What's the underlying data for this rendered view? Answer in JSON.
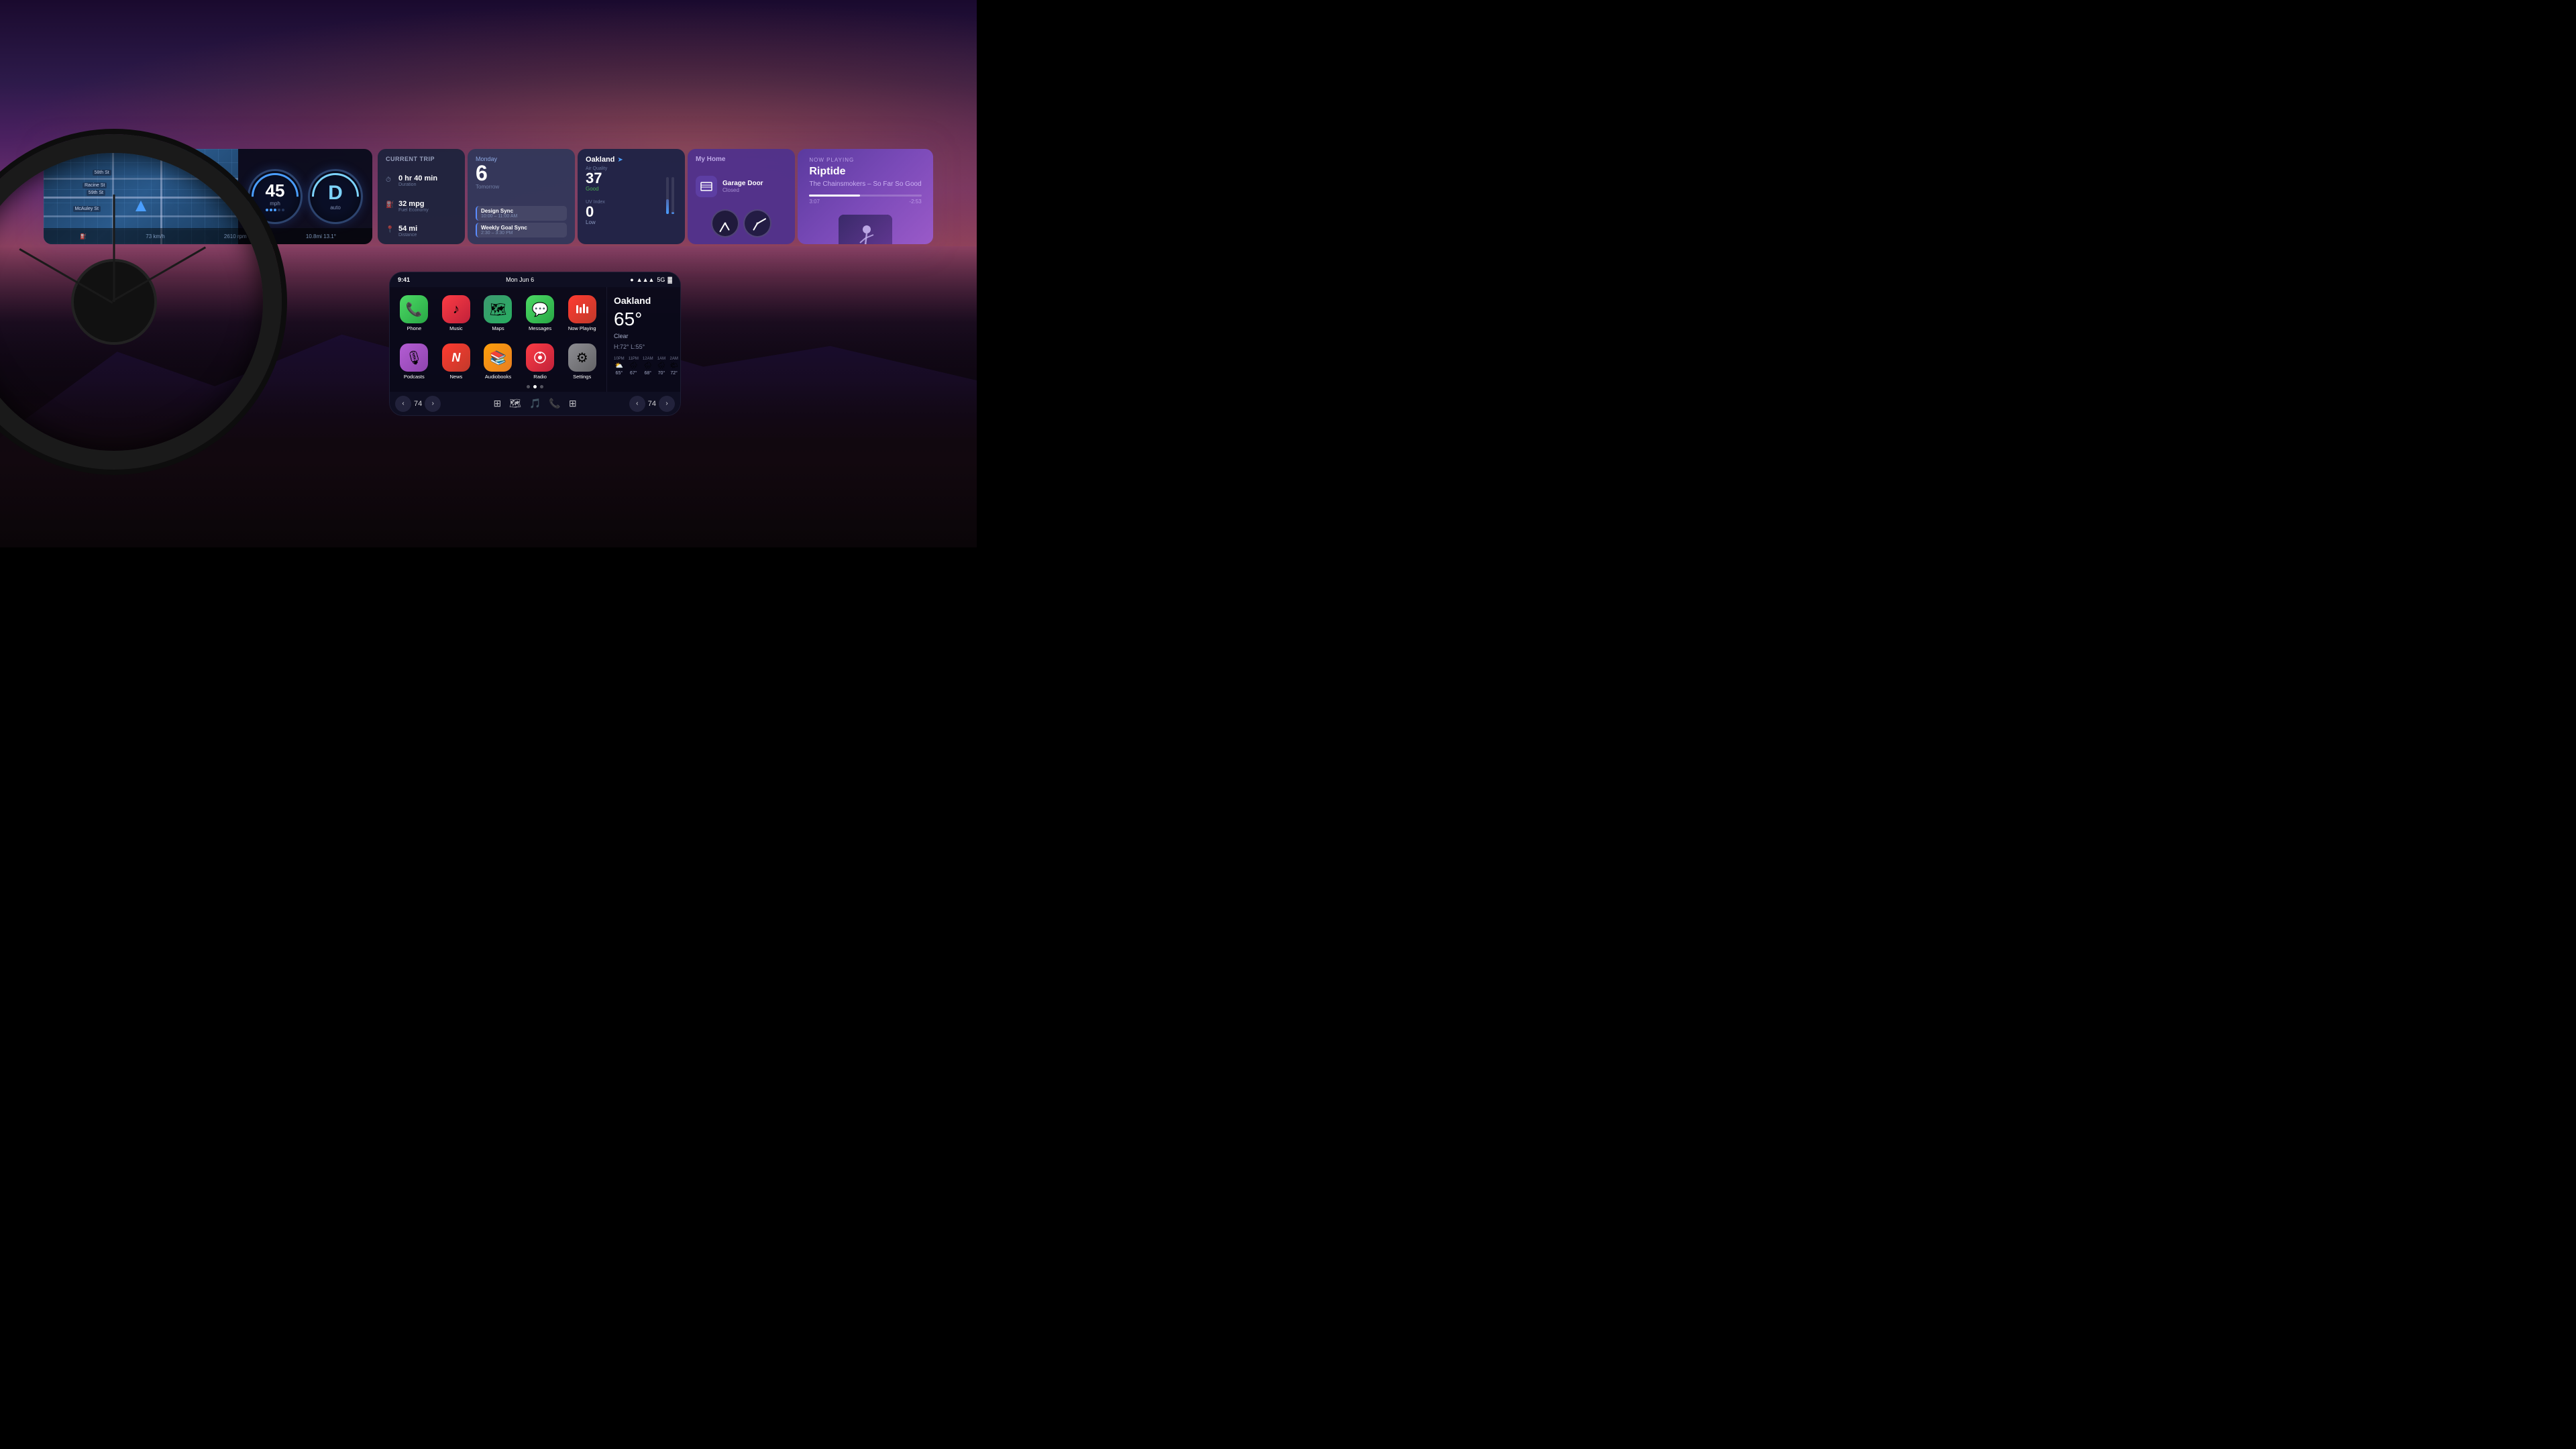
{
  "background": {
    "description": "Car interior at dusk with mountain scenery"
  },
  "dashboard": {
    "cluster": {
      "speed": "45",
      "speed_unit": "mph",
      "gear": "D",
      "gear_label": "auto",
      "speed_metric": "73 km/h",
      "rpm": "2610 rpm",
      "compass": "10.8mi  13.1°",
      "fuel": "⛽"
    },
    "trip": {
      "title": "Current Trip",
      "duration_value": "0 hr 40 min",
      "duration_label": "Duration",
      "economy_value": "32 mpg",
      "economy_label": "Fuel Economy",
      "distance_value": "54 mi",
      "distance_label": "Distance"
    },
    "calendar": {
      "day": "Monday",
      "date": "6",
      "date_sub": "Tomorrow",
      "events": [
        {
          "title": "Design Sync",
          "time": "10:00 – 11:00 AM"
        },
        {
          "title": "Weekly Goal Sync",
          "time": "2:30 – 3:30 PM"
        }
      ]
    },
    "weather": {
      "city": "Oakland",
      "arrow_icon": "➤",
      "air_quality_label": "Air Quality",
      "air_quality_value": "37",
      "air_quality_rating": "Good",
      "uv_label": "UV Index",
      "uv_value": "0",
      "uv_rating": "Low"
    },
    "home": {
      "title": "My Home",
      "device_name": "Garage Door",
      "device_status": "Closed",
      "device_icon": "🏠",
      "clock1_label": "",
      "clock2_label": ""
    },
    "now_playing": {
      "label": "Now Playing",
      "title": "Riptide",
      "artist": "The Chainsmokers – So Far So Good",
      "time_current": "3:07",
      "time_total": "-2:53",
      "progress_percent": 55
    }
  },
  "carplay": {
    "status_bar": {
      "time": "9:41",
      "date": "Mon Jun 6"
    },
    "apps": [
      {
        "name": "Phone",
        "icon": "📞",
        "class": "app-phone"
      },
      {
        "name": "Music",
        "icon": "🎵",
        "class": "app-music"
      },
      {
        "name": "Maps",
        "icon": "🗺",
        "class": "app-maps"
      },
      {
        "name": "Messages",
        "icon": "💬",
        "class": "app-messages"
      },
      {
        "name": "Now Playing",
        "icon": "▶",
        "class": "app-nowplaying"
      },
      {
        "name": "Podcasts",
        "icon": "🎙",
        "class": "app-podcasts"
      },
      {
        "name": "News",
        "icon": "📰",
        "class": "app-news"
      },
      {
        "name": "Audiobooks",
        "icon": "📚",
        "class": "app-audiobooks"
      },
      {
        "name": "Radio",
        "icon": "📻",
        "class": "app-radio"
      },
      {
        "name": "Settings",
        "icon": "⚙",
        "class": "app-settings"
      }
    ],
    "weather": {
      "city": "Oakland",
      "temperature": "65°",
      "description": "Clear",
      "high": "H:72°",
      "low": "L:55°",
      "hourly": [
        {
          "time": "10PM",
          "icon": "⛅",
          "temp": "65°"
        },
        {
          "time": "11PM",
          "icon": "🌧",
          "temp": "67°"
        },
        {
          "time": "12AM",
          "icon": "🌧",
          "temp": "68°"
        },
        {
          "time": "1AM",
          "icon": "🌧",
          "temp": "70°"
        },
        {
          "time": "2AM",
          "icon": "🌤",
          "temp": "72°"
        }
      ]
    },
    "bottom": {
      "temp_left": "74",
      "temp_right": "74"
    }
  }
}
